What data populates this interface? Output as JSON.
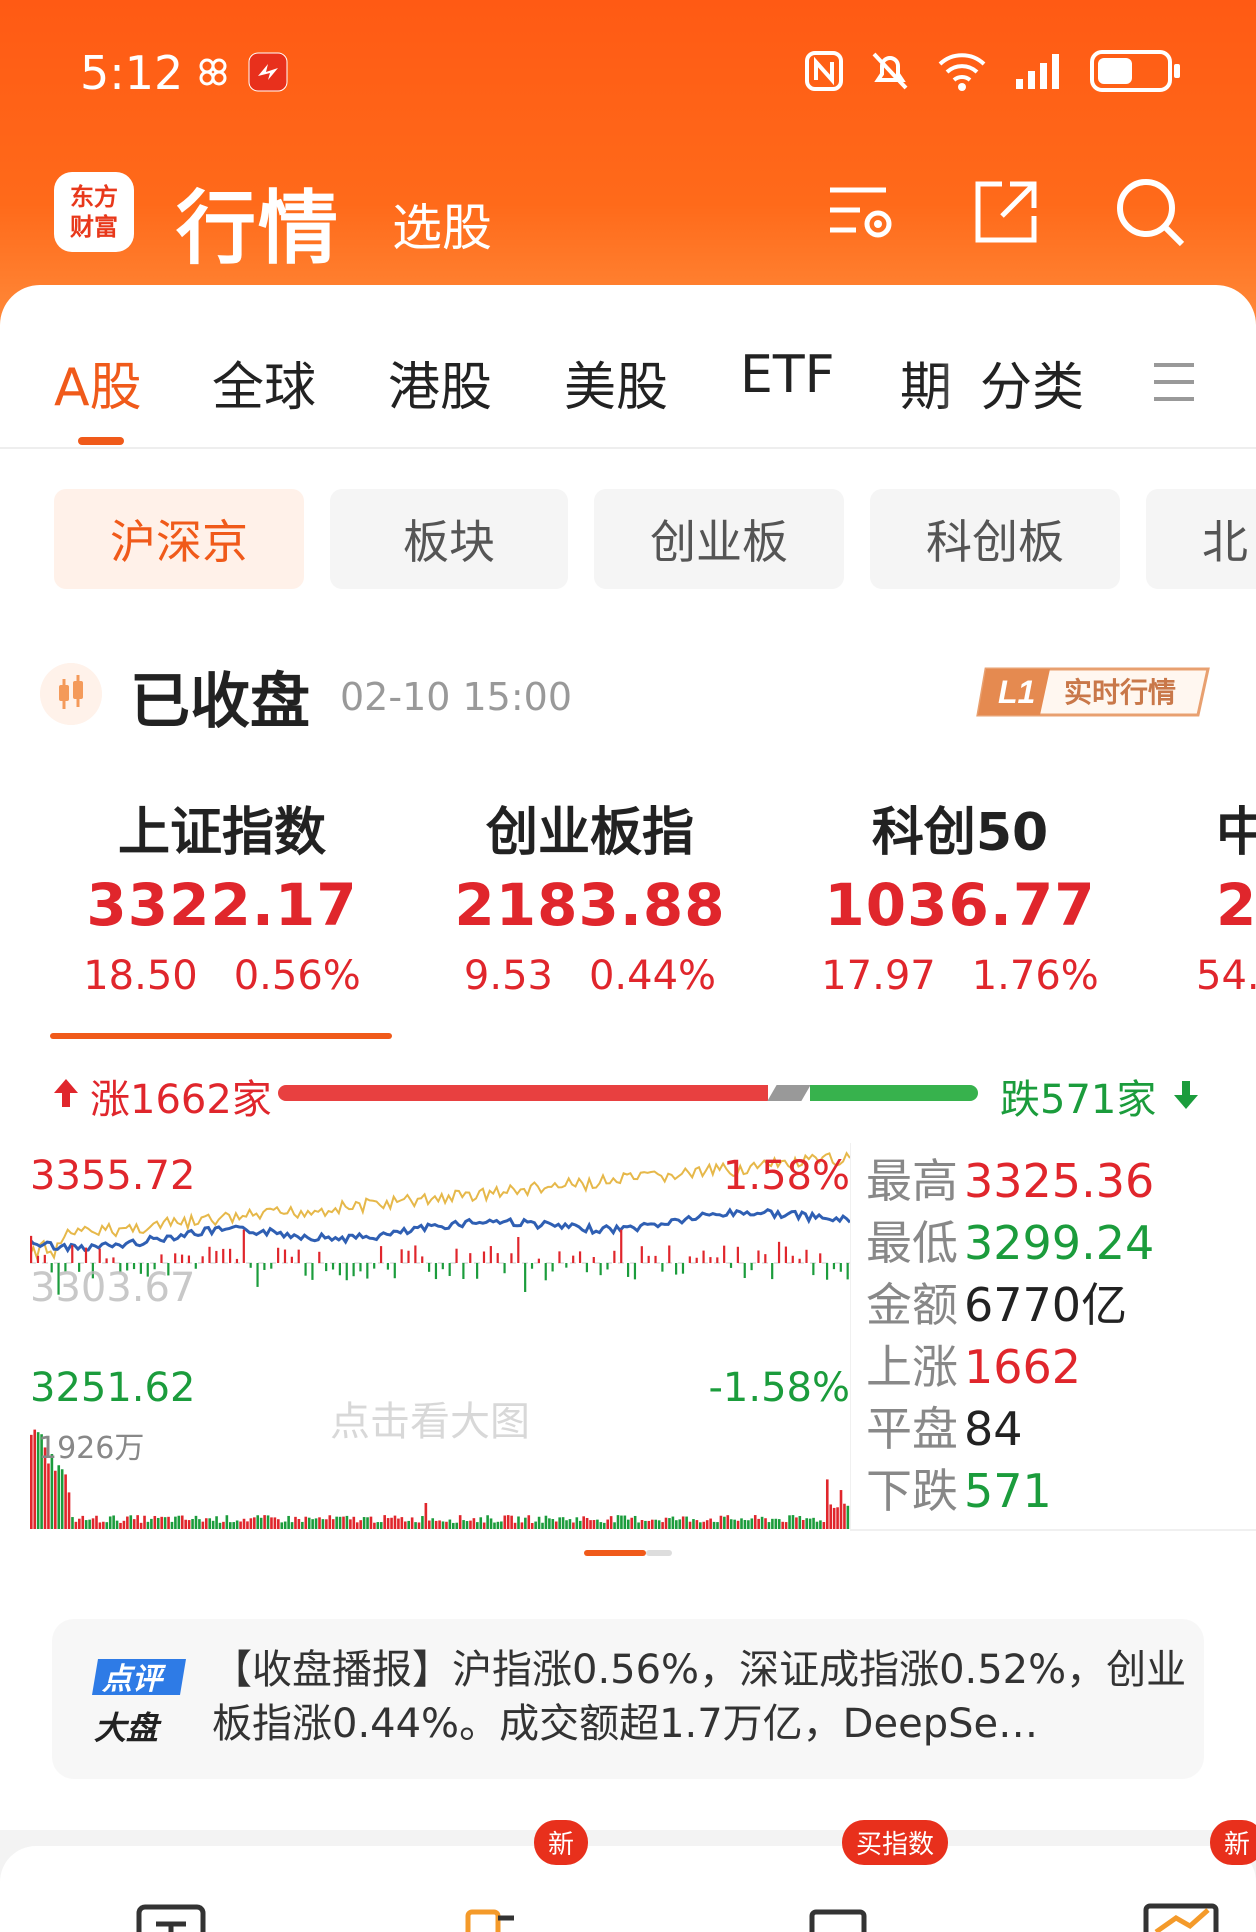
{
  "status_bar": {
    "time": "5:12"
  },
  "app_bar": {
    "logo_line1": "东方",
    "logo_line2": "财富",
    "title": "行情",
    "subtitle": "选股"
  },
  "tabs": [
    "A股",
    "全球",
    "港股",
    "美股",
    "ETF",
    "期",
    "分类"
  ],
  "subtabs": [
    "沪深京",
    "板块",
    "创业板",
    "科创板",
    "北"
  ],
  "market_status": {
    "label": "已收盘",
    "time": "02-10 15:00",
    "badge_l1": "L1",
    "badge_text": "实时行情"
  },
  "indices": [
    {
      "name": "上证指数",
      "price": "3322.17",
      "change": "18.50",
      "pct": "0.56%"
    },
    {
      "name": "创业板指",
      "price": "2183.88",
      "change": "9.53",
      "pct": "0.44%"
    },
    {
      "name": "科创50",
      "price": "1036.77",
      "change": "17.97",
      "pct": "1.76%"
    },
    {
      "name": "中",
      "price": "2",
      "change": "54.",
      "pct": ""
    }
  ],
  "breadth": {
    "up_label": "涨1662家",
    "down_label": "跌571家",
    "up": 1662,
    "flat": 84,
    "down": 571
  },
  "chart": {
    "high_label": "3355.72",
    "high_pct": "1.58%",
    "mid_label": "3303.67",
    "low_label": "3251.62",
    "low_pct": "-1.58%",
    "volume_label": "1926万",
    "watermark": "点击看大图"
  },
  "stats": [
    {
      "key": "最高",
      "value": "3325.36",
      "color": "#e0262c"
    },
    {
      "key": "最低",
      "value": "3299.24",
      "color": "#1b9c3c"
    },
    {
      "key": "金额",
      "value": "6770亿",
      "color": "#222222"
    },
    {
      "key": "上涨",
      "value": "1662",
      "color": "#e0262c"
    },
    {
      "key": "平盘",
      "value": "84",
      "color": "#222222"
    },
    {
      "key": "下跌",
      "value": "571",
      "color": "#1b9c3c"
    }
  ],
  "news": {
    "badge_line1": "点评",
    "badge_line2": "大盘",
    "text": "【收盘播报】沪指涨0.56%，深证成指涨0.52%，创业板指涨0.44%。成交额超1.7万亿，DeepSe…"
  },
  "bottom_tags": [
    "新",
    "买指数",
    "新"
  ],
  "colors": {
    "brand": "#ff5a14",
    "up": "#e0262c",
    "down": "#1b9c3c",
    "accent": "#f05a1a"
  }
}
